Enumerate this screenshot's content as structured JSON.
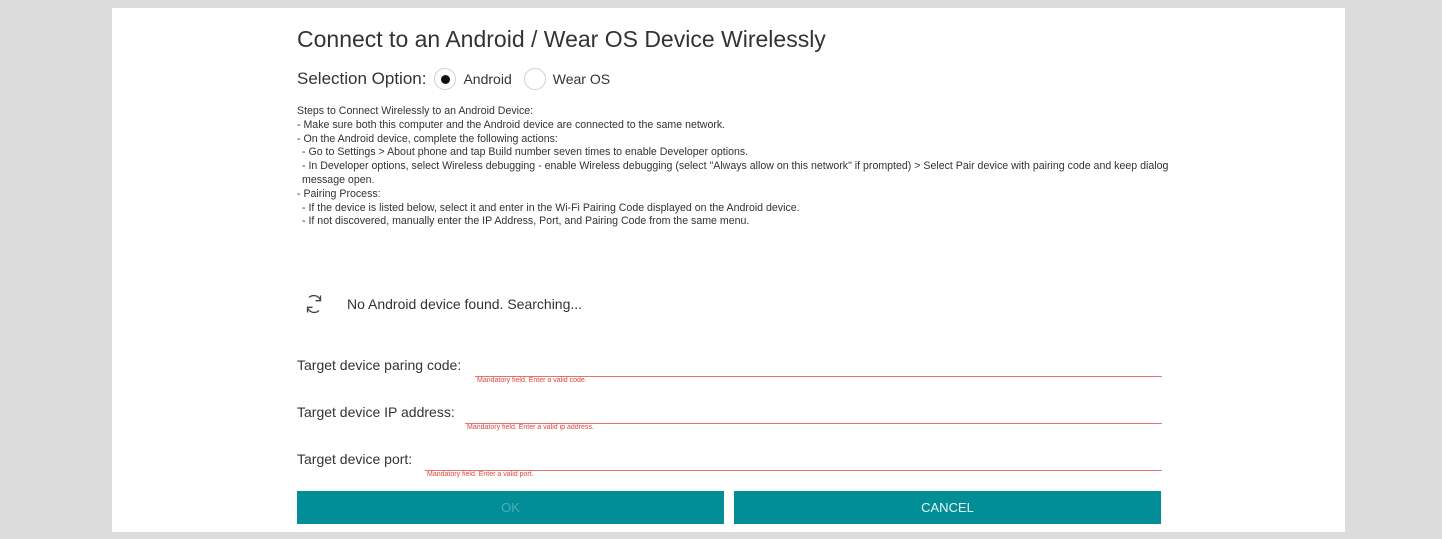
{
  "dialog": {
    "title": "Connect to an Android / Wear OS Device Wirelessly",
    "selection_label": "Selection Option:",
    "options": [
      {
        "label": "Android",
        "selected": true
      },
      {
        "label": "Wear OS",
        "selected": false
      }
    ]
  },
  "steps": {
    "heading": "Steps to Connect Wirelessly to an Android Device:",
    "line1": "- Make sure both this computer and the Android device are connected to the same network.",
    "line2": "- On the Android device, complete the following actions:",
    "line3": "- Go to Settings > About phone and tap Build number seven times to enable Developer options.",
    "line4": "- In Developer options, select Wireless debugging - enable Wireless debugging (select \"Always allow on this network\" if prompted) > Select Pair device with pairing code and keep dialog message open.",
    "line5": "- Pairing Process:",
    "line6": "- If the device is listed below, select it and enter in the Wi-Fi Pairing Code displayed on the Android device.",
    "line7": "- If not discovered, manually enter the IP Address, Port, and Pairing Code from the same menu."
  },
  "search": {
    "icon": "refresh-icon",
    "status": "No Android device found. Searching..."
  },
  "fields": {
    "pairing_code": {
      "label": "Target device paring code:",
      "value": "",
      "error": "Mandatory field. Enter a valid code."
    },
    "ip_address": {
      "label": "Target device IP address:",
      "value": "",
      "error": "Mandatory field. Enter a valid ip address."
    },
    "port": {
      "label": "Target device port:",
      "value": "",
      "error": "Mandatory field. Enter a valid port."
    }
  },
  "buttons": {
    "ok": "OK",
    "cancel": "CANCEL"
  },
  "colors": {
    "accent": "#028e96",
    "error": "#e0453a",
    "background": "#dcdcdc"
  }
}
